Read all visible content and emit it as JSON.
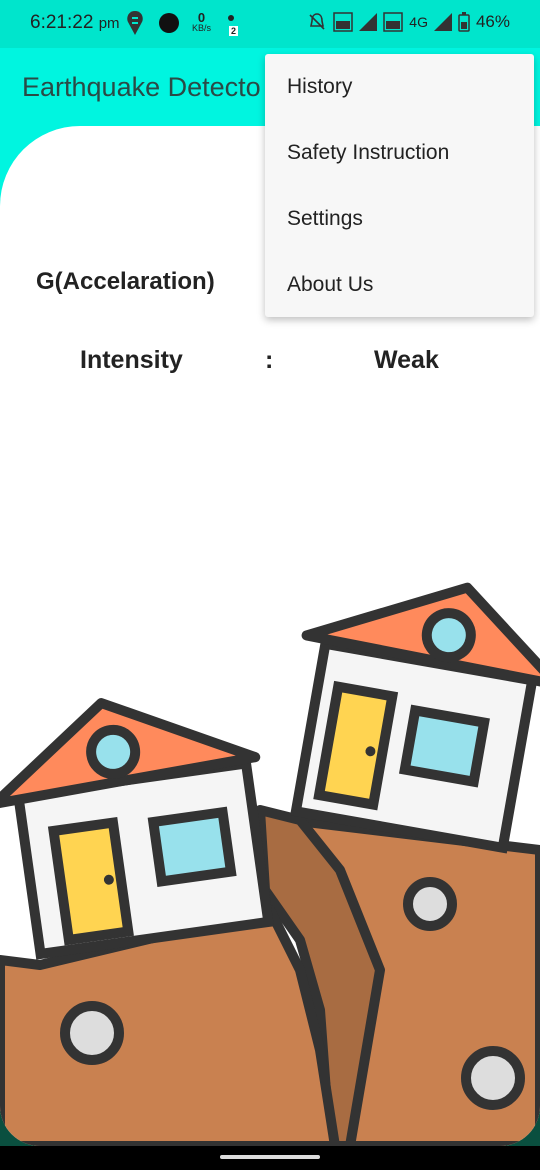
{
  "status": {
    "time": "6:21:22",
    "ampm": "pm",
    "speed_value": "0",
    "speed_unit": "KB/s",
    "notif_badge": "2",
    "network": "4G",
    "battery": "46%"
  },
  "app": {
    "title": "Earthquake Detecto"
  },
  "readings": {
    "g_label": "G(Accelaration)",
    "intensity_label": "Intensity",
    "separator": ":",
    "intensity_value": "Weak"
  },
  "menu": {
    "items": [
      {
        "label": "History"
      },
      {
        "label": "Safety Instruction"
      },
      {
        "label": "Settings"
      },
      {
        "label": "About Us"
      }
    ]
  },
  "icons": [
    "swiggy-icon",
    "circle-icon",
    "dot-icon",
    "mute-bell-icon",
    "volte-icon",
    "signal-icon",
    "battery-icon"
  ],
  "colors": {
    "status_bar": "#00e5cc",
    "app_bar": "#00f5e0",
    "ground": "#c98150",
    "roof": "#ff8a5c"
  }
}
